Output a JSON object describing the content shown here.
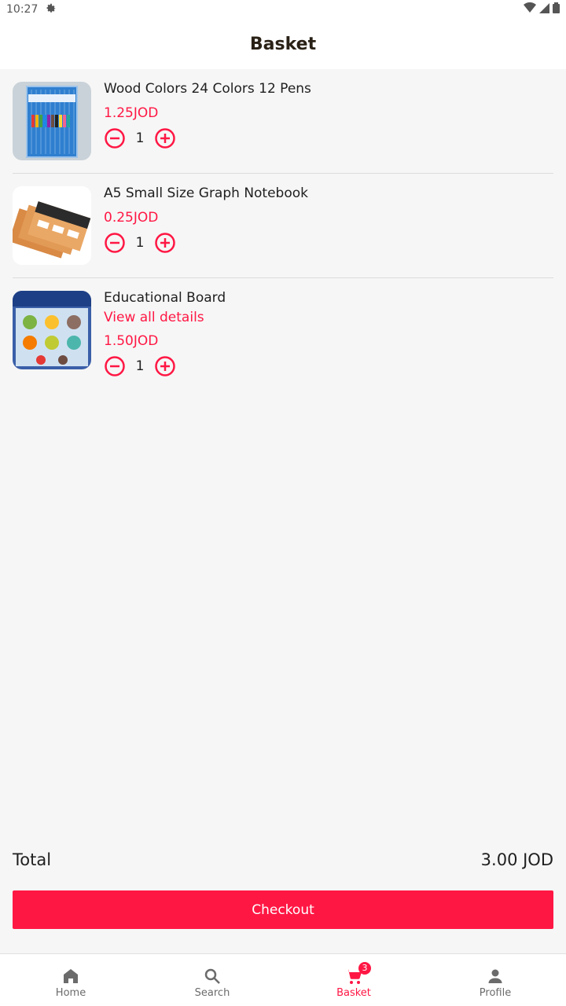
{
  "status_bar": {
    "time": "10:27"
  },
  "header": {
    "title": "Basket"
  },
  "items": [
    {
      "name": "Wood Colors 24 Colors 12 Pens",
      "link": "",
      "price": "1.25JOD",
      "quantity": "1"
    },
    {
      "name": "A5 Small Size Graph Notebook",
      "link": "",
      "price": "0.25JOD",
      "quantity": "1"
    },
    {
      "name": "Educational Board",
      "link": "View all details",
      "price": "1.50JOD",
      "quantity": "1"
    }
  ],
  "total": {
    "label": "Total",
    "value": "3.00 JOD"
  },
  "checkout_label": "Checkout",
  "nav": {
    "home": "Home",
    "search": "Search",
    "basket": "Basket",
    "basket_badge": "3",
    "profile": "Profile"
  },
  "colors": {
    "accent": "#ff1744",
    "background": "#f6f6f6"
  }
}
